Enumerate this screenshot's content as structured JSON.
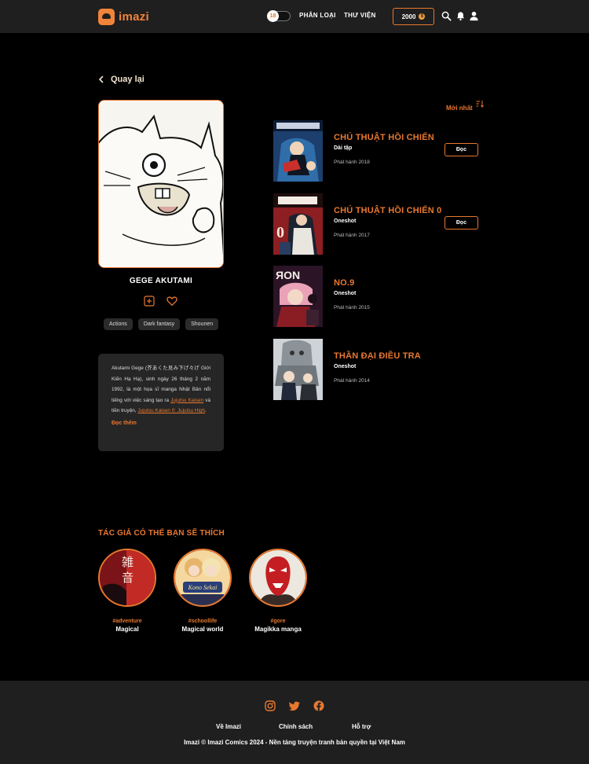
{
  "header": {
    "logo_text": "imazi",
    "age_badge": "18",
    "nav": [
      "PHÂN LOẠI",
      "THƯ VIỆN"
    ],
    "coins": "2000",
    "coin_symbol": "$"
  },
  "back_label": "Quay lại",
  "author": {
    "name": "GEGE AKUTAMI",
    "tags": [
      "Actions",
      "Dark fantasy",
      "Shounen"
    ],
    "bio_pre": "Akutami Gege (芥あくた見み下げ々げ Giới Kiến Hạ Hạ), sinh ngày 26 tháng 2 năm 1992, là một họa sĩ manga Nhật Bản nổi tiếng với việc sáng tạo ra ",
    "bio_link1": "Jujutsu Kaisen",
    "bio_mid": " và tiền truyện, ",
    "bio_link2": "Jujutsu Kaisen 0: Jujutsu High",
    "bio_end": ".",
    "read_more": "Đọc thêm"
  },
  "sort_label": "Mới nhất",
  "manga": [
    {
      "title": "CHÚ THUẬT HỒI CHIẾN",
      "type": "Dài tập",
      "year": "Phát hành 2018",
      "button": "Đọc"
    },
    {
      "title": "CHÚ THUẬT HỒI CHIẾN 0",
      "type": "Oneshot",
      "year": "Phát hành 2017",
      "button": "Đọc"
    },
    {
      "title": "NO.9",
      "type": "Oneshot",
      "year": "Phát hành 2015"
    },
    {
      "title": "THẦN ĐẠI ĐIỀU TRA",
      "type": "Oneshot",
      "year": "Phát hành 2014"
    }
  ],
  "suggestions": {
    "title": "TÁC GIẢ CÓ THỂ BẠN SẼ THÍCH",
    "items": [
      {
        "tag": "#adventure",
        "name": "Magical"
      },
      {
        "tag": "#schoollife",
        "name": "Magical world"
      },
      {
        "tag": "#gore",
        "name": "Magikka manga"
      }
    ]
  },
  "footer": {
    "links": [
      "Về Imazi",
      "Chính sách",
      "Hỗ trợ"
    ],
    "copyright": "Imazi © Imazi Comics 2024  - Nền tảng truyện tranh bản quyền tại Việt Nam"
  },
  "colors": {
    "accent": "#e8782f",
    "background": "#000000",
    "surface": "#1f1f1f"
  },
  "icons": [
    "search-icon",
    "bell-icon",
    "user-icon",
    "back-chevron-icon",
    "add-icon",
    "heart-icon",
    "sort-icon",
    "instagram-icon",
    "twitter-icon",
    "facebook-icon"
  ]
}
